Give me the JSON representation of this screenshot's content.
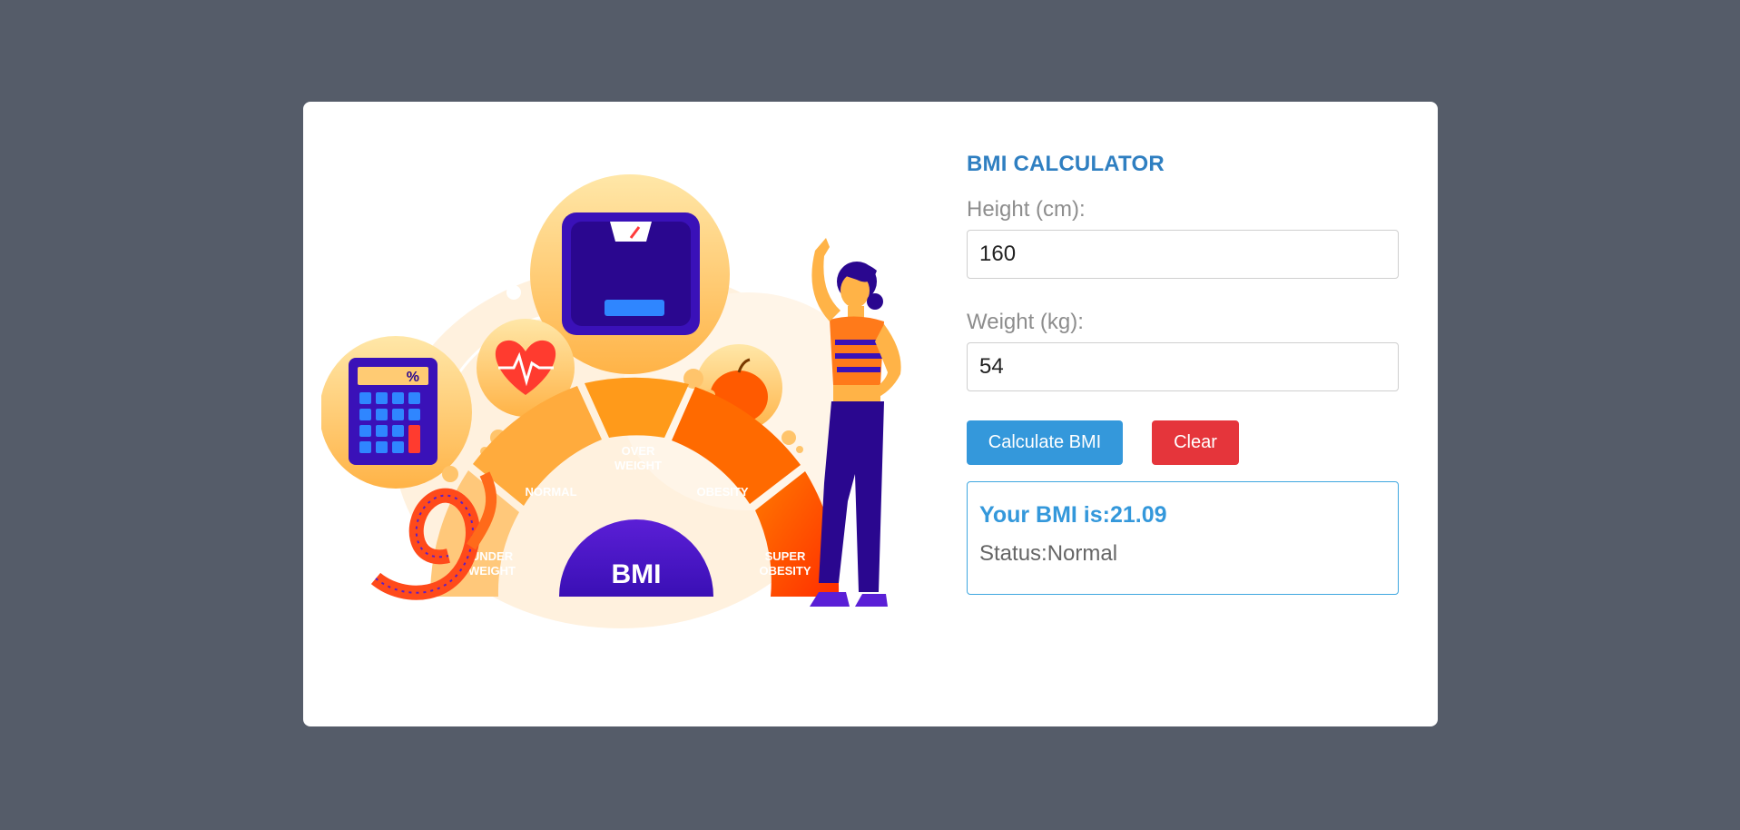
{
  "app": {
    "title": "BMI CALCULATOR"
  },
  "form": {
    "height_label": "Height (cm):",
    "height_value": "160",
    "weight_label": "Weight (kg):",
    "weight_value": "54",
    "calculate_label": "Calculate BMI",
    "clear_label": "Clear"
  },
  "result": {
    "bmi_text": "Your BMI is:21.09",
    "status_text": "Status:Normal"
  },
  "illustration": {
    "calculator_symbol": "%",
    "center_label": "BMI",
    "segments": {
      "under_1": "UNDER",
      "under_2": "WEIGHT",
      "normal": "NORMAL",
      "over_1": "OVER",
      "over_2": "WEIGHT",
      "obesity": "OBESITY",
      "super_1": "SUPER",
      "super_2": "OBESITY"
    },
    "icons": [
      "calculator-icon",
      "heart-icon",
      "scale-icon",
      "apple-icon",
      "measuring-tape-icon",
      "woman-figure"
    ]
  },
  "colors": {
    "background": "#555c69",
    "card": "#ffffff",
    "accent_blue": "#3498db",
    "title_blue": "#2f7fc1",
    "danger_red": "#e5353b"
  }
}
